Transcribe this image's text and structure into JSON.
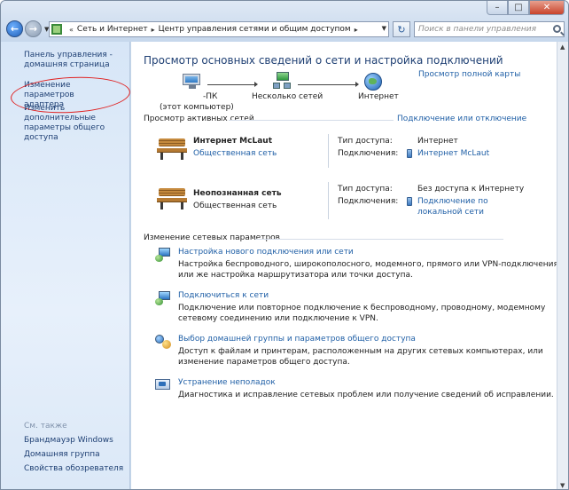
{
  "address": {
    "crumbs": [
      "Сеть и Интернет",
      "Центр управления сетями и общим доступом"
    ]
  },
  "search": {
    "placeholder": "Поиск в панели управления"
  },
  "sidebar": {
    "home_link": "Панель управления - домашняя страница",
    "items": [
      "Изменение параметров адаптера",
      "Изменить дополнительные параметры общего доступа"
    ],
    "see_also_label": "См. также",
    "see_also": [
      "Брандмауэр Windows",
      "Домашняя группа",
      "Свойства обозревателя"
    ]
  },
  "main": {
    "title": "Просмотр основных сведений о сети и настройка подключений",
    "full_map_link": "Просмотр полной карты",
    "map": {
      "computer_name": "-ПК",
      "computer_sub": "(этот компьютер)",
      "networks": "Несколько сетей",
      "internet": "Интернет"
    },
    "active_header": "Просмотр активных сетей",
    "connect_link": "Подключение или отключение",
    "networks": [
      {
        "name": "Интернет McLaut",
        "type": "Общественная сеть",
        "access_label": "Тип доступа:",
        "access_value": "Интернет",
        "conn_label": "Подключения:",
        "conn_value": "Интернет McLaut"
      },
      {
        "name": "Неопознанная сеть",
        "type": "Общественная сеть",
        "access_label": "Тип доступа:",
        "access_value": "Без доступа к Интернету",
        "conn_label": "Подключения:",
        "conn_value_1": "Подключение по",
        "conn_value_2": "локальной сети"
      }
    ],
    "change_header": "Изменение сетевых параметров",
    "tasks": [
      {
        "title": "Настройка нового подключения или сети",
        "desc1": "Настройка беспроводного, широкополосного, модемного, прямого или VPN-подключения",
        "desc2": "или же настройка маршрутизатора или точки доступа."
      },
      {
        "title": "Подключиться к сети",
        "desc1": "Подключение или повторное подключение к беспроводному, проводному, модемному",
        "desc2": "сетевому соединению или подключение к VPN."
      },
      {
        "title": "Выбор домашней группы и параметров общего доступа",
        "desc1": "Доступ к файлам и принтерам, расположенным на других сетевых компьютерах, или",
        "desc2": "изменение параметров общего доступа."
      },
      {
        "title": "Устранение неполадок",
        "desc1": "Диагностика и исправление сетевых проблем или получение сведений об исправлении."
      }
    ]
  }
}
